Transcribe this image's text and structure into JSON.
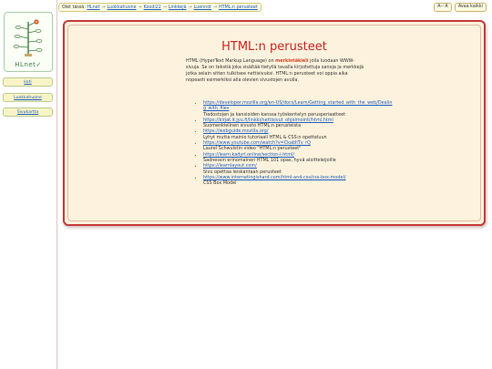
{
  "breadcrumb": {
    "prefix": "Olet tässä:",
    "items": [
      "HLnet",
      "Luokkahuone",
      "Koodi22",
      "Linkkejä",
      "Luennot",
      "HTML:n perusteet"
    ],
    "separator": "→"
  },
  "topbar": {
    "font_button": "A-- A",
    "expand_button": "Avaa kaikki"
  },
  "logo": {
    "text": "HLnet✓"
  },
  "sidebar": {
    "items": [
      {
        "label": "koti"
      },
      {
        "label": "Luokkahuone"
      },
      {
        "label": "Sivukartta"
      }
    ]
  },
  "main": {
    "title": "HTML:n perusteet",
    "intro": {
      "before": "HTML (HyperText Markup Language) on ",
      "highlight": "merkintäkieli",
      "after": " jolla luodaan WWW-sivuja. Se on tekstiä joka sisältää tietyllä tavalla kirjoitettuja sanoja ja merkkejä jotka selain sitten tulkitsee nettisivuksi. HTML:n perusteet voi oppia aika nopeasti esimerkiksi alla olevien sivustojen avulla."
    },
    "links": [
      {
        "url": "https://developer.mozilla.org/en-US/docs/Learn/Getting_started_with_the_web/Dealing_with_files",
        "desc": "Tiedostojen ja kansioiden kanssa työskentelyn perusperiaatteet"
      },
      {
        "url": "https://kirjat.it.jyu.fi/linkki/nettisivut_ohjelmointi/html.html",
        "desc": "Suomenkielinen sivusto HTML:n perusteista"
      },
      {
        "url": "https://webguide.mozilla.org/",
        "desc": "Lyhyt mutta mainio tutoriaali HTML & CSS:n opetteluun"
      },
      {
        "url": "https://www.youtube.com/watch?v=CkabIITv_rQ",
        "desc": "Laurel Schwulstin video \"HTML:n perusteet\""
      },
      {
        "url": "https://learn.kadyrl.online/section-i-html/",
        "desc": "Sadnessin erinomainen HTML 101 opas, hyvä aloitteleijoille"
      },
      {
        "url": "https://learnlayout.com/",
        "desc": "Sivu opettaa leiskantaan perusteet"
      },
      {
        "url": "https://www.internetingishard.com/html-and-css/css-box-model/",
        "desc": "CSS Box Model"
      }
    ]
  },
  "colors": {
    "title": "#cc2222",
    "card_border": "#c63a3a",
    "card_background": "#fdf2dd",
    "link": "#1f5fbf",
    "highlight": "#d4452b"
  }
}
